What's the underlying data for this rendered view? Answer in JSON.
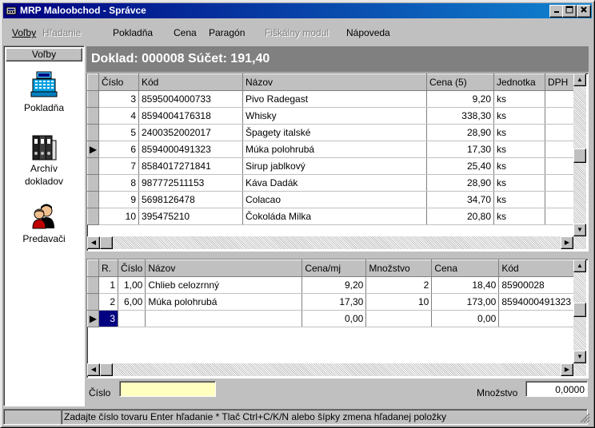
{
  "window": {
    "title": "MRP Maloobchod - Správce"
  },
  "menu": [
    {
      "label": "Voľby",
      "enabled": true
    },
    {
      "label": "Hľadanie",
      "enabled": false
    },
    {
      "label": "Pokladňa",
      "enabled": true
    },
    {
      "label": "Cena",
      "enabled": true
    },
    {
      "label": "Paragón",
      "enabled": true
    },
    {
      "label": "Fiškálny modul",
      "enabled": false
    },
    {
      "label": "Nápoveda",
      "enabled": true
    }
  ],
  "sidebar": {
    "header": "Voľby",
    "items": [
      {
        "label": "Pokladňa",
        "icon": "cash-register-icon"
      },
      {
        "label": "Archív\ndokladov",
        "icon": "binders-icon"
      },
      {
        "label": "Predavači",
        "icon": "people-icon"
      }
    ]
  },
  "document": {
    "header": "Doklad: 000008  Súčet: 191,40"
  },
  "products": {
    "columns": [
      "Číslo",
      "Kód",
      "Názov",
      "Cena (5)",
      "Jednotka",
      "DPH"
    ],
    "rows": [
      [
        "3",
        "8595004000733",
        "Pivo Radegast",
        "9,20",
        "ks",
        ""
      ],
      [
        "4",
        "8594004176318",
        "Whisky",
        "338,30",
        "ks",
        ""
      ],
      [
        "5",
        "2400352002017",
        "Špagety italské",
        "28,90",
        "ks",
        ""
      ],
      [
        "6",
        "8594000491323",
        "Múka polohrubá",
        "17,30",
        "ks",
        ""
      ],
      [
        "7",
        "8584017271841",
        "Sirup jablkový",
        "25,40",
        "ks",
        ""
      ],
      [
        "8",
        "987772511153",
        "Káva Dadák",
        "28,90",
        "ks",
        ""
      ],
      [
        "9",
        "5698126478",
        "Colacao",
        "34,70",
        "ks",
        ""
      ],
      [
        "10",
        "395475210",
        "Čokoláda Milka",
        "20,80",
        "ks",
        ""
      ]
    ],
    "current_row": 3
  },
  "receipt": {
    "columns": [
      "R.",
      "Číslo",
      "Názov",
      "Cena/mj",
      "Množstvo",
      "Cena",
      "Kód"
    ],
    "rows": [
      [
        "1",
        "1,00",
        "Chlieb celozrnný",
        "9,20",
        "2",
        "18,40",
        "85900028"
      ],
      [
        "2",
        "6,00",
        "Múka polohrubá",
        "17,30",
        "10",
        "173,00",
        "8594000491323"
      ],
      [
        "3",
        "",
        "",
        "0,00",
        "",
        "0,00",
        ""
      ]
    ],
    "current_row": 2
  },
  "footer": {
    "cislo_label": "Číslo",
    "cislo_value": "",
    "mnozstvo_label": "Množstvo",
    "mnozstvo_value": "0,0000"
  },
  "status": "Zadajte číslo tovaru  Enter hľadanie  * Tlač  Ctrl+C/K/N alebo šípky zmena hľadanej položky"
}
